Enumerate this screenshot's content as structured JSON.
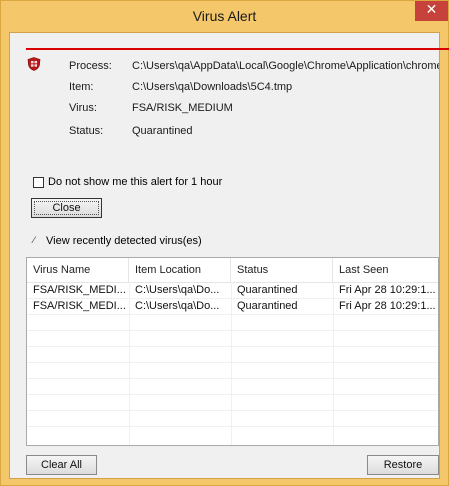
{
  "window": {
    "title": "Virus Alert",
    "close_glyph": "✕"
  },
  "alert": {
    "icon": "shield-icon",
    "fields": [
      {
        "label": "Process:",
        "value": "C:\\Users\\qa\\AppData\\Local\\Google\\Chrome\\Application\\chrome.e"
      },
      {
        "label": "Item:",
        "value": "C:\\Users\\qa\\Downloads\\5C4.tmp"
      },
      {
        "label": "Virus:",
        "value": "FSA/RISK_MEDIUM"
      },
      {
        "label": "Status:",
        "value": "Quarantined"
      }
    ]
  },
  "options": {
    "suppress_label": "Do not show me this alert for 1 hour",
    "suppress_checked": false,
    "close_button": "Close",
    "view_toggle_glyph": "⁄",
    "view_label": "View recently detected virus(es)"
  },
  "table": {
    "columns": [
      "Virus Name",
      "Item Location",
      "Status",
      "Last Seen"
    ],
    "rows": [
      [
        "FSA/RISK_MEDI...",
        "C:\\Users\\qa\\Do...",
        "Quarantined",
        "Fri Apr 28 10:29:1..."
      ],
      [
        "FSA/RISK_MEDI...",
        "C:\\Users\\qa\\Do...",
        "Quarantined",
        "Fri Apr 28 10:29:1..."
      ]
    ]
  },
  "footer": {
    "clear_button": "Clear All",
    "restore_button": "Restore"
  },
  "colors": {
    "accent_red": "#d80000",
    "titlebar": "#f3c76a",
    "close_button": "#c7423a"
  }
}
